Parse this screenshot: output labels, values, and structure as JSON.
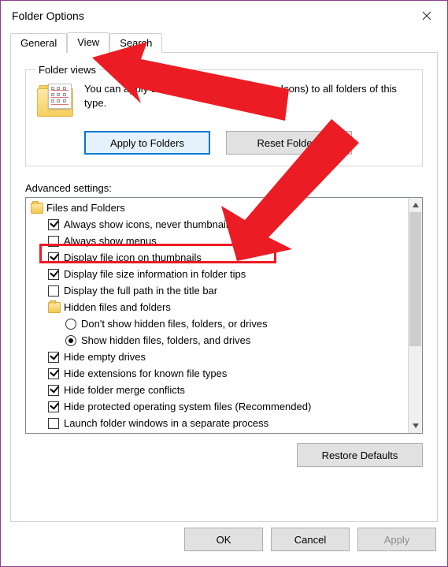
{
  "window": {
    "title": "Folder Options"
  },
  "tabs": {
    "general": "General",
    "view": "View",
    "search": "Search",
    "active": "View"
  },
  "folder_views": {
    "legend": "Folder views",
    "description": "You can apply this view (such as Details or Icons) to all folders of this type.",
    "apply_btn": "Apply to Folders",
    "reset_btn": "Reset Folders"
  },
  "advanced": {
    "label": "Advanced settings:",
    "group_header": "Files and Folders",
    "items": [
      {
        "label": "Always show icons, never thumbnails",
        "checked": true,
        "type": "check"
      },
      {
        "label": "Always show menus",
        "checked": false,
        "type": "check"
      },
      {
        "label": "Display file icon on thumbnails",
        "checked": true,
        "type": "check"
      },
      {
        "label": "Display file size information in folder tips",
        "checked": true,
        "type": "check"
      },
      {
        "label": "Display the full path in the title bar",
        "checked": false,
        "type": "check"
      },
      {
        "label": "Hidden files and folders",
        "type": "folder"
      },
      {
        "label": "Don't show hidden files, folders, or drives",
        "checked": false,
        "type": "radio"
      },
      {
        "label": "Show hidden files, folders, and drives",
        "checked": true,
        "type": "radio"
      },
      {
        "label": "Hide empty drives",
        "checked": true,
        "type": "check"
      },
      {
        "label": "Hide extensions for known file types",
        "checked": true,
        "type": "check"
      },
      {
        "label": "Hide folder merge conflicts",
        "checked": true,
        "type": "check"
      },
      {
        "label": "Hide protected operating system files (Recommended)",
        "checked": true,
        "type": "check"
      },
      {
        "label": "Launch folder windows in a separate process",
        "checked": false,
        "type": "check"
      }
    ],
    "restore_btn": "Restore Defaults"
  },
  "buttons": {
    "ok": "OK",
    "cancel": "Cancel",
    "apply": "Apply"
  },
  "colors": {
    "annotation": "#ec1c24",
    "accent": "#0078d7"
  }
}
